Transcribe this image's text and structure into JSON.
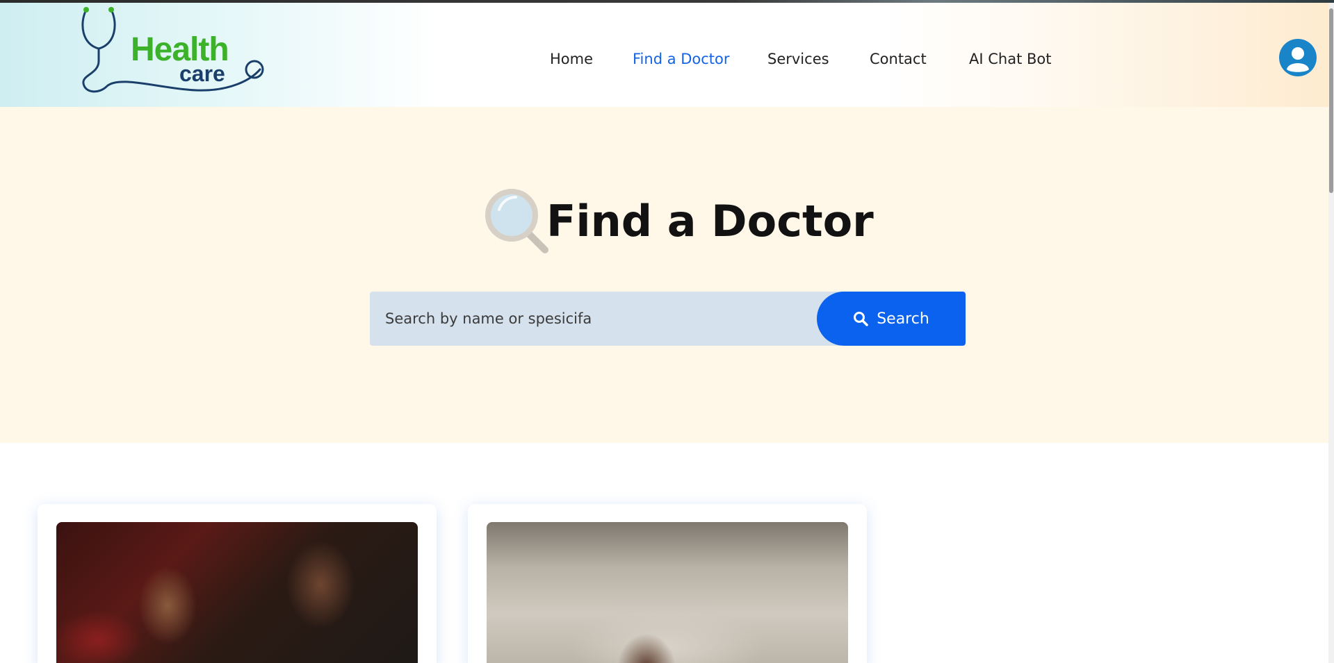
{
  "header": {
    "logo": {
      "word1": "Health",
      "word2": "care"
    },
    "nav": [
      {
        "label": "Home",
        "active": false
      },
      {
        "label": "Find a Doctor",
        "active": true
      },
      {
        "label": "Services",
        "active": false
      },
      {
        "label": "Contact",
        "active": false
      },
      {
        "label": "AI Chat Bot",
        "active": false
      }
    ],
    "avatar_icon": "user-avatar-icon"
  },
  "hero": {
    "icon": "magnifying-glass-icon",
    "title": "Find a Doctor",
    "search": {
      "placeholder": "Search by name or spesicifa",
      "value": "",
      "button_label": "Search",
      "button_icon": "search-icon"
    }
  },
  "colors": {
    "accent": "#0a62ee",
    "nav_active": "#1463e6",
    "hero_bg": "#fff8e8",
    "search_bg": "#d5e1ec",
    "logo_green": "#3cb22a",
    "logo_navy": "#1b3f6b"
  },
  "doctor_cards": [
    {
      "photo": "group-photo"
    },
    {
      "photo": "metro-photo"
    }
  ]
}
